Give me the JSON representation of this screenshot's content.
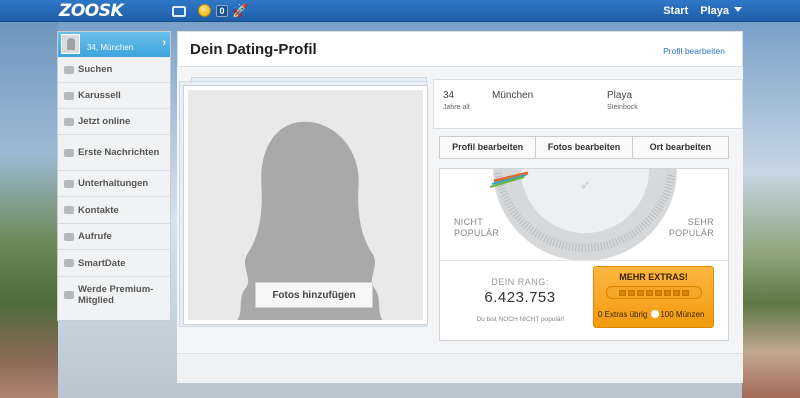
{
  "topbar": {
    "logo": "ZOOSK",
    "coins_count": "0",
    "start_label": "Start",
    "user_label": "Playa"
  },
  "sidebar": {
    "user_info": "34, München",
    "items": [
      {
        "label": "Suchen",
        "icon": "search-icon"
      },
      {
        "label": "Karussell",
        "icon": "carousel-icon"
      },
      {
        "label": "Jetzt online",
        "icon": "online-icon"
      },
      {
        "label": "Erste Nachrichten",
        "icon": "envelope-icon"
      },
      {
        "label": "Unterhaltungen",
        "icon": "chat-icon"
      },
      {
        "label": "Kontakte",
        "icon": "contacts-icon"
      },
      {
        "label": "Aufrufe",
        "icon": "views-icon"
      },
      {
        "label": "SmartDate",
        "icon": "smartdate-icon"
      },
      {
        "label": "Werde Premium-Mitglied",
        "icon": "premium-icon"
      }
    ]
  },
  "header": {
    "title": "Dein Dating-Profil",
    "edit_link": "Profil bearbeiten"
  },
  "photo": {
    "add_label": "Fotos hinzufügen"
  },
  "info": {
    "age": "34",
    "age_sub": "Jahre alt",
    "city": "München",
    "name": "Playa",
    "sign": "Steinbock"
  },
  "buttons": {
    "edit_profile": "Profil bearbeiten",
    "edit_photos": "Fotos bearbeiten",
    "edit_location": "Ort bearbeiten"
  },
  "popularity": {
    "left_label_1": "NICHT",
    "left_label_2": "POPULÄR",
    "right_label_1": "SEHR",
    "right_label_2": "POPULÄR",
    "rank_label": "DEIN RANG:",
    "rank_value": "6.423.753",
    "rank_note": "Du bist NOCH NICHT populär!"
  },
  "extras": {
    "title": "MEHR EXTRAS!",
    "remaining": "0 Extras übrig",
    "coins": "100 Münzen",
    "slot_count": 8,
    "accent_color": "#f5a623"
  },
  "colors": {
    "topbar": "#2a6fbf",
    "sidebar_active": "#4db0e4",
    "link": "#2a75c8"
  }
}
